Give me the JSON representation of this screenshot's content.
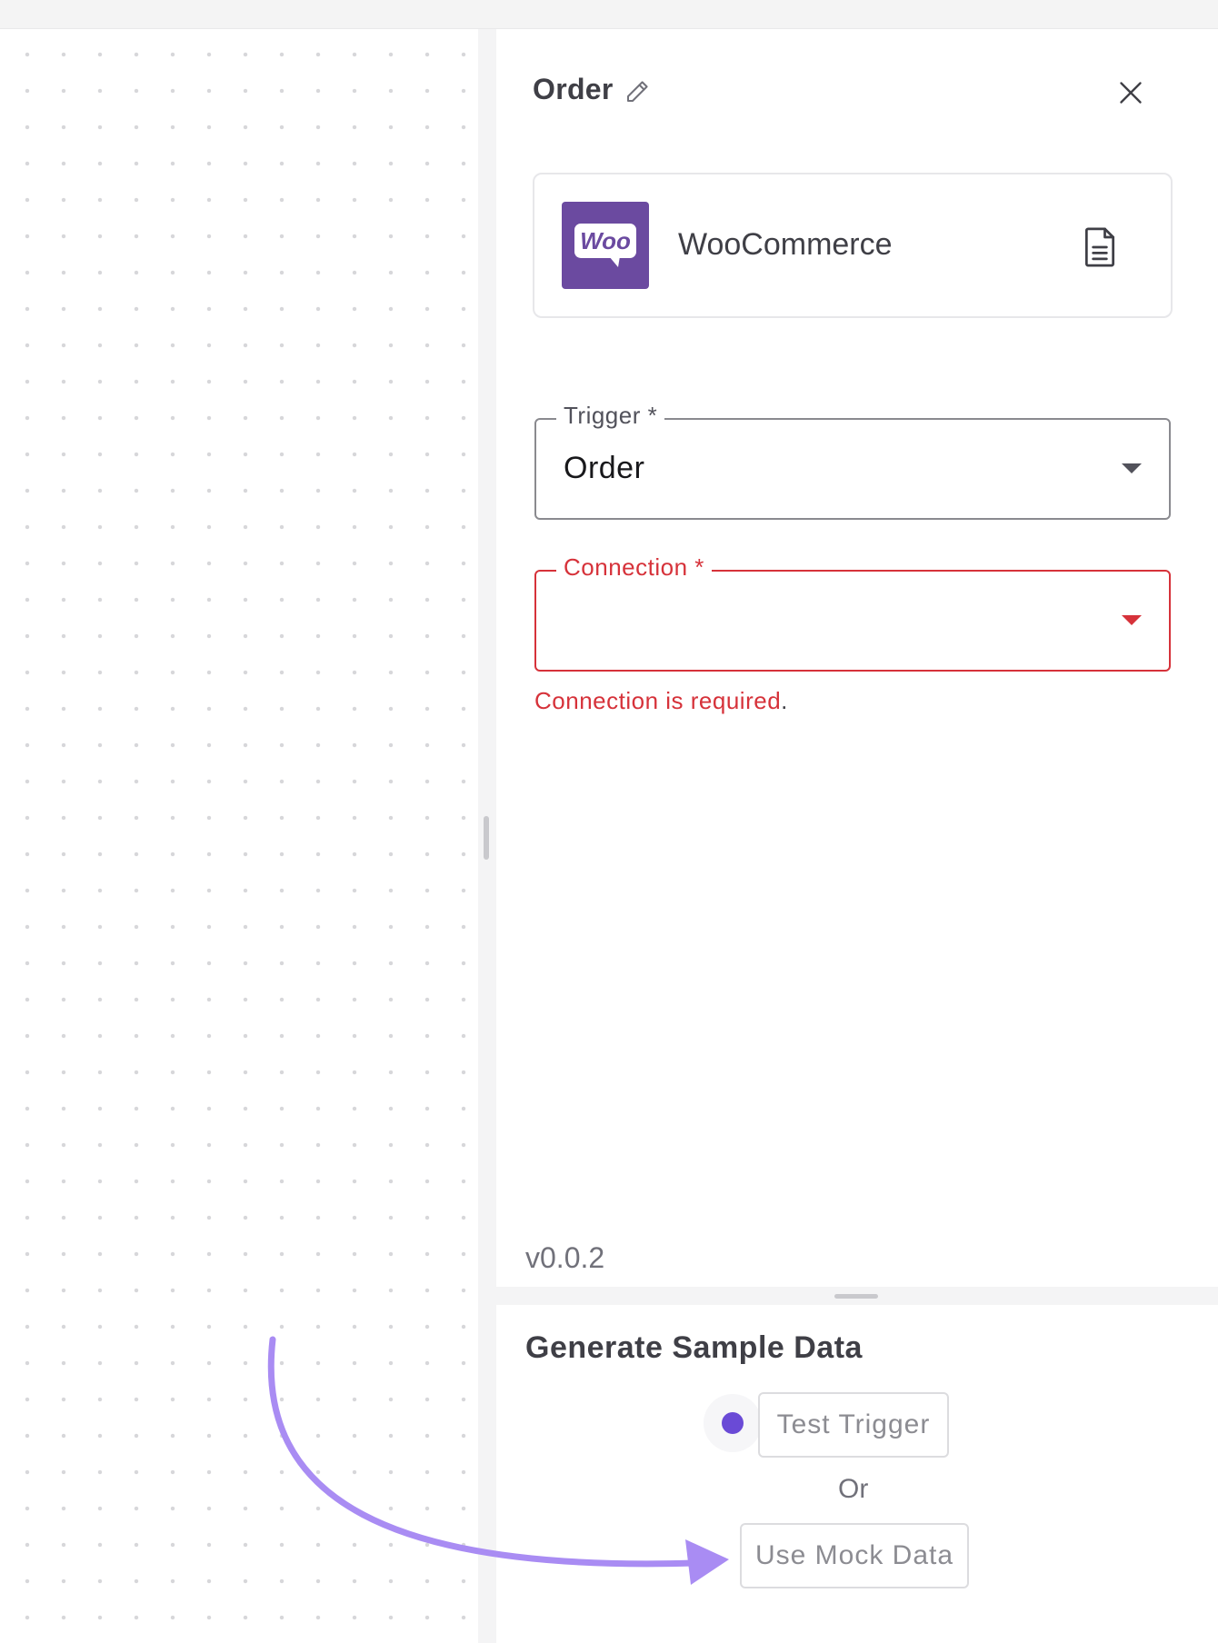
{
  "panel": {
    "title": "Order",
    "app": {
      "name": "WooCommerce",
      "logo_text": "Woo",
      "logo_color": "#6b4aa0"
    },
    "trigger": {
      "label": "Trigger  *",
      "value": "Order"
    },
    "connection": {
      "label": "Connection  *",
      "value": "",
      "error": "Connection is required",
      "error_suffix": "."
    },
    "version": "v0.0.2"
  },
  "sample_data": {
    "title": "Generate Sample Data",
    "test_trigger_label": "Test Trigger",
    "or_label": "Or",
    "mock_data_label": "Use Mock Data",
    "status_color": "#6a4ad6"
  },
  "annotation": {
    "arrow_color": "#a98cf3"
  },
  "colors": {
    "error": "#d6323a",
    "accent": "#6a4ad6"
  },
  "icons": [
    "edit-icon",
    "close-icon",
    "document-icon",
    "chevron-down-icon"
  ]
}
